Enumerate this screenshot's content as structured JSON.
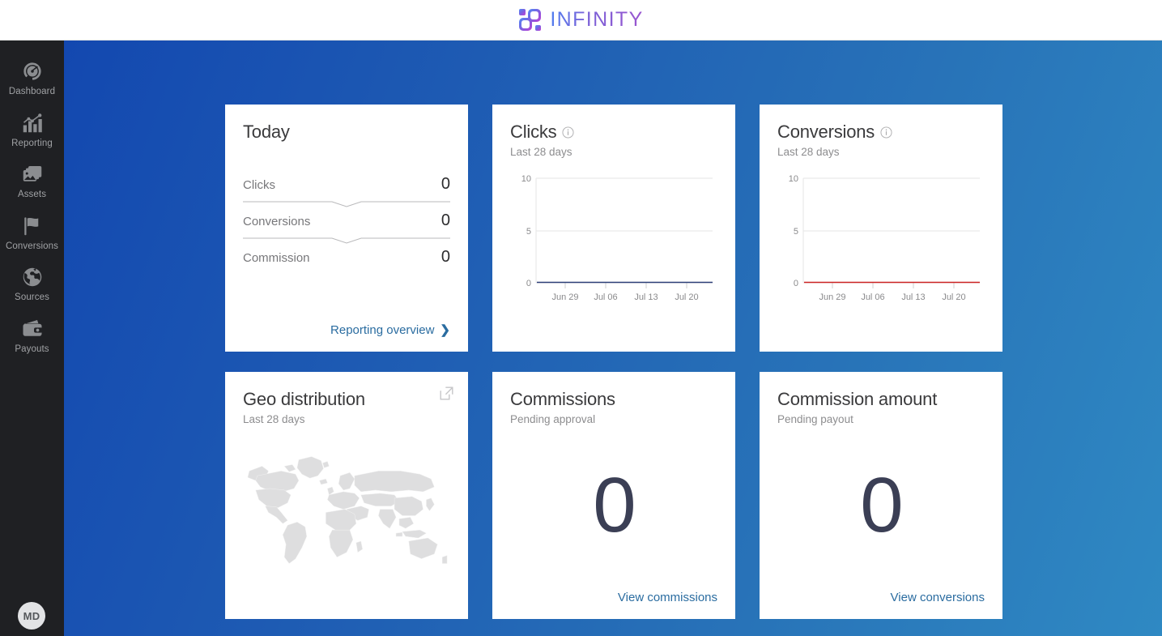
{
  "header": {
    "brand": "INFINITY",
    "logo_icon": "infinity-grid-logo-icon"
  },
  "sidebar": {
    "items": [
      {
        "label": "Dashboard",
        "icon": "gauge-icon"
      },
      {
        "label": "Reporting",
        "icon": "bar-chart-icon"
      },
      {
        "label": "Assets",
        "icon": "images-icon"
      },
      {
        "label": "Conversions",
        "icon": "flag-icon"
      },
      {
        "label": "Sources",
        "icon": "globe-icon"
      },
      {
        "label": "Payouts",
        "icon": "wallet-icon"
      }
    ],
    "avatar": {
      "initials": "MD"
    }
  },
  "cards": {
    "today": {
      "title": "Today",
      "rows": [
        {
          "label": "Clicks",
          "value": "0"
        },
        {
          "label": "Conversions",
          "value": "0"
        },
        {
          "label": "Commission",
          "value": "0"
        }
      ],
      "link": "Reporting overview",
      "chevron": "❯"
    },
    "clicks": {
      "title": "Clicks",
      "subtitle": "Last 28 days",
      "info_icon": "info-circle-icon"
    },
    "conversions": {
      "title": "Conversions",
      "subtitle": "Last 28 days",
      "info_icon": "info-circle-icon"
    },
    "geo": {
      "title": "Geo distribution",
      "subtitle": "Last 28 days",
      "expand_icon": "external-link-icon"
    },
    "commissions": {
      "title": "Commissions",
      "subtitle": "Pending approval",
      "value": "0",
      "link": "View commissions"
    },
    "commission_amount": {
      "title": "Commission amount",
      "subtitle": "Pending payout",
      "value": "0",
      "link": "View conversions"
    }
  },
  "chart_data": [
    {
      "type": "line",
      "title": "Clicks",
      "subtitle": "Last 28 days",
      "xlabel": "",
      "ylabel": "",
      "ylim": [
        0,
        10
      ],
      "yticks": [
        "0",
        "5",
        "10"
      ],
      "xticks": [
        "Jun 29",
        "Jul 06",
        "Jul 13",
        "Jul 20"
      ],
      "grid": true,
      "legend": "none",
      "series": [
        {
          "name": "Clicks",
          "color": "#2c3e77",
          "values": [
            0,
            0,
            0,
            0,
            0,
            0,
            0,
            0,
            0,
            0,
            0,
            0,
            0,
            0,
            0,
            0,
            0,
            0,
            0,
            0,
            0,
            0,
            0,
            0,
            0,
            0,
            0,
            0
          ]
        }
      ]
    },
    {
      "type": "line",
      "title": "Conversions",
      "subtitle": "Last 28 days",
      "xlabel": "",
      "ylabel": "",
      "ylim": [
        0,
        10
      ],
      "yticks": [
        "0",
        "5",
        "10"
      ],
      "xticks": [
        "Jun 29",
        "Jul 06",
        "Jul 13",
        "Jul 20"
      ],
      "grid": true,
      "legend": "none",
      "series": [
        {
          "name": "Conversions",
          "color": "#cc2222",
          "values": [
            0,
            0,
            0,
            0,
            0,
            0,
            0,
            0,
            0,
            0,
            0,
            0,
            0,
            0,
            0,
            0,
            0,
            0,
            0,
            0,
            0,
            0,
            0,
            0,
            0,
            0,
            0,
            0
          ]
        }
      ]
    }
  ],
  "colors": {
    "accent_link": "#2a6ca0",
    "bg_gradient_start": "#1348b0",
    "bg_gradient_end": "#2f89c3",
    "sidebar_bg": "#1f2023",
    "clicks_line": "#2c3e77",
    "conversions_line": "#cc2222",
    "big_number": "#3b3f55"
  }
}
